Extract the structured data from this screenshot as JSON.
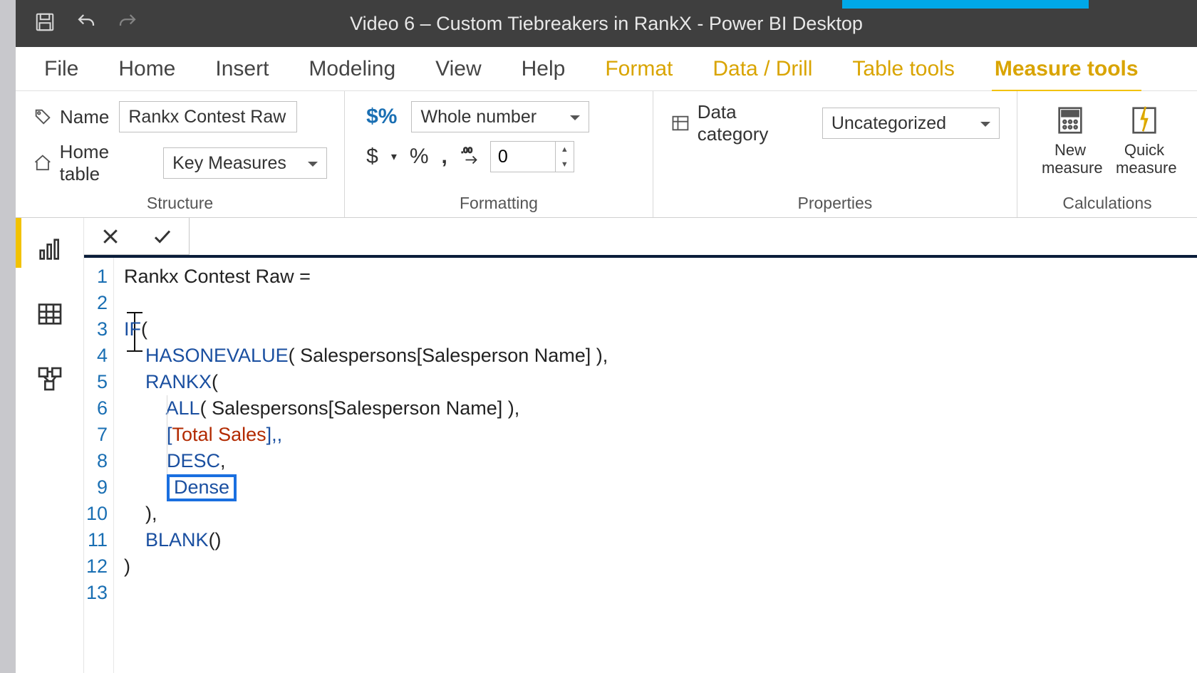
{
  "title": "Video 6 – Custom Tiebreakers in RankX - Power BI Desktop",
  "ribbon_tabs": {
    "file": "File",
    "home": "Home",
    "insert": "Insert",
    "modeling": "Modeling",
    "view": "View",
    "help": "Help",
    "format": "Format",
    "data_drill": "Data / Drill",
    "table_tools": "Table tools",
    "measure_tools": "Measure tools"
  },
  "structure": {
    "name_label": "Name",
    "name_value": "Rankx Contest Raw",
    "home_table_label": "Home table",
    "home_table_value": "Key Measures",
    "group_label": "Structure"
  },
  "formatting": {
    "format_value": "Whole number",
    "decimals": "0",
    "group_label": "Formatting"
  },
  "properties": {
    "data_category_label": "Data category",
    "data_category_value": "Uncategorized",
    "group_label": "Properties"
  },
  "calculations": {
    "new_measure": "New measure",
    "quick_measure": "Quick measure",
    "group_label": "Calculations"
  },
  "code": {
    "l1": "Rankx Contest Raw =",
    "l3_if": "IF",
    "l3_rest": "(",
    "l4_fn": "HASONEVALUE",
    "l4_rest": "( Salespersons[Salesperson Name] ),",
    "l5_fn": "RANKX",
    "l5_rest": "(",
    "l6_fn": "ALL",
    "l6_rest": "( Salespersons[Salesperson Name] ),",
    "l7_open": "[",
    "l7_meas": "Total Sales",
    "l7_close": "],,",
    "l8_kw": "DESC",
    "l8_rest": ",",
    "l9_kw": "Dense",
    "l10": "),",
    "l11_fn": "BLANK",
    "l11_rest": "()",
    "l12": ")"
  },
  "line_numbers": [
    "1",
    "2",
    "3",
    "4",
    "5",
    "6",
    "7",
    "8",
    "9",
    "10",
    "11",
    "12",
    "13"
  ]
}
